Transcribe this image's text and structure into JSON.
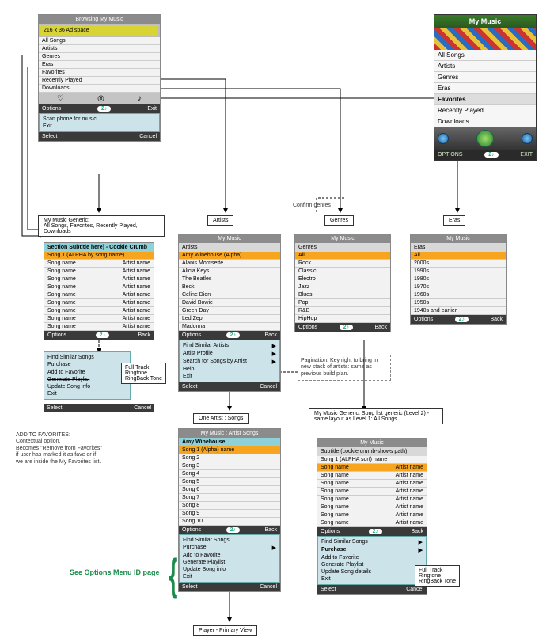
{
  "ad_space": "216 x 36 Ad space",
  "softkeys": {
    "options": "Options",
    "back": "Back",
    "exit": "Exit",
    "select": "Select",
    "cancel": "Cancel"
  },
  "pill": "2♪",
  "main_panel": {
    "title": "Browsing My Music",
    "items": [
      "All Songs",
      "Artists",
      "Genres",
      "Eras",
      "Favorites",
      "Recently Played",
      "Downloads"
    ],
    "scan_menu": [
      "Scan phone for music",
      "Exit"
    ]
  },
  "phone": {
    "title": "My Music",
    "items": [
      "All Songs",
      "Artists",
      "Genres",
      "Eras",
      "Favorites",
      "Recently Played",
      "Downloads"
    ],
    "selected_idx": 4,
    "foot_left": "OPTIONS",
    "foot_right": "EXIT",
    "pill": "2♪"
  },
  "labels": {
    "generic": "My Music Generic:\nAll Songs, Favorites, Recently Played, Downloads",
    "artists": "Artists",
    "genres": "Genres",
    "eras": "Eras",
    "artist_songs": "One Artist : Songs",
    "level2": "My Music Generic: Song list generic (Level 2) - same layout as Level 1: All Songs",
    "player": "Player - Primary View",
    "confirm": "Confirm genres",
    "pagination": "Pagination: Key right to bring in new stack of artists: same as previous build plan."
  },
  "section_panel": {
    "title": "Section Subtitle here) - Cookie Crumb",
    "header": "Song 1 (ALPHA by song name)",
    "rows": [
      {
        "a": "Song name",
        "b": "Artist name"
      },
      {
        "a": "Song name",
        "b": "Artist name"
      },
      {
        "a": "Song name",
        "b": "Artist name"
      },
      {
        "a": "Song name",
        "b": "Artist name"
      },
      {
        "a": "Song name",
        "b": "Artist name"
      },
      {
        "a": "Song name",
        "b": "Artist name"
      },
      {
        "a": "Song name",
        "b": "Artist name"
      },
      {
        "a": "Song name",
        "b": "Artist name"
      },
      {
        "a": "Song name",
        "b": "Artist name"
      }
    ],
    "menu": [
      "Find Similar Songs",
      "Purchase",
      "Add to Favorite",
      "Generate Playlist",
      "Update Song info",
      "Exit"
    ],
    "strike_idx": 3,
    "flyout": [
      "Full Track",
      "Ringtone",
      "RingBack Tone"
    ]
  },
  "artists_panel": {
    "title": "My Music",
    "subtitle": "Artists",
    "header": "Amy Winehouse  (Alpha)",
    "rows": [
      "Alanis Morrisette",
      "Alicia Keys",
      "The Beatles",
      "Beck",
      "Celine Dion",
      "David Bowie",
      "Green Day",
      "Led Zep",
      "Madonna"
    ],
    "menu": [
      "Find Similar Artists",
      "Artist Profile",
      "Search for Songs by Artist",
      "Help",
      "Exit"
    ]
  },
  "genres_panel": {
    "title": "My Music",
    "subtitle": "Genres",
    "header": "All",
    "rows": [
      "Rock",
      "Classic",
      "Electro",
      "Jazz",
      "Blues",
      "Pop",
      "R&B",
      "HipHop"
    ]
  },
  "eras_panel": {
    "title": "My Music",
    "subtitle": "Eras",
    "header": "All",
    "rows": [
      "2000s",
      "1990s",
      "1980s",
      "1970s",
      "1960s",
      "1950s",
      "1940s and earlier"
    ]
  },
  "artist_songs_panel": {
    "title": "My Music : Artist Songs",
    "subtitle": "Amy Winehouse",
    "header": "Song 1 (Alpha) name",
    "rows": [
      "Song 2",
      "Song 3",
      "Song 4",
      "Song 5",
      "Song 6",
      "Song 7",
      "Song 8",
      "Song 9",
      "Song 10"
    ],
    "menu": [
      "Find Similar Songs",
      "Purchase",
      "Add to Favorite",
      "Generate Playlist",
      "Update Song info",
      "Exit"
    ]
  },
  "level2_panel": {
    "title": "My Music",
    "subtitle": "Subtitle (cookie crumb-shows path)",
    "header_row": {
      "a": "Song 1 (ALPHA sort) name",
      "b": ""
    },
    "hl_row": {
      "a": "Song name",
      "b": "Artist name"
    },
    "rows": [
      {
        "a": "Song name",
        "b": "Artist name"
      },
      {
        "a": "Song name",
        "b": "Artist name"
      },
      {
        "a": "Song name",
        "b": "Artist name"
      },
      {
        "a": "Song name",
        "b": "Artist name"
      },
      {
        "a": "Song name",
        "b": "Artist name"
      },
      {
        "a": "Song name",
        "b": "Artist name"
      },
      {
        "a": "Song name",
        "b": "Artist name"
      }
    ],
    "menu": [
      "Find Similar Songs",
      "Purchase",
      "Add to Favorite",
      "Generate Playlist",
      "Update Song details",
      "Exit"
    ],
    "bold_idx": 1,
    "flyout": [
      "Full Track",
      "Ringtone",
      "RingBack Tone"
    ]
  },
  "notes": {
    "fav": "ADD TO FAVORITES:\nContextual option.\nBecomes \"Remove from Favorites\" if user has marked it  as fave or if we are inside the My Favorites list.",
    "options_link": "See Options Menu ID page"
  }
}
